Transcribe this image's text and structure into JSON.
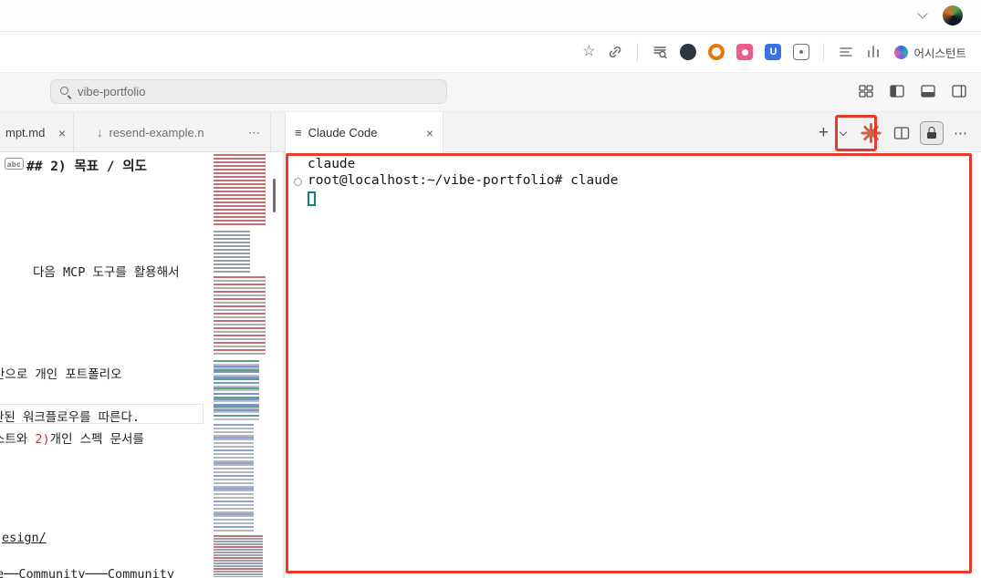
{
  "browser": {
    "assistant_label": "어시스턴트",
    "blue_ext_letter": "U"
  },
  "command_center": {
    "query": "vibe-portfolio"
  },
  "icons": {
    "star": "☆",
    "close": "×",
    "more": "⋯",
    "plus": "+",
    "file_arrow": "↓",
    "terminal_lines": "≡",
    "ellipsis": "⋯"
  },
  "tabs": [
    {
      "label": "mpt.md"
    },
    {
      "label": "resend-example.n"
    },
    {
      "label": "Claude Code"
    }
  ],
  "editor": {
    "badge": "abc",
    "heading": "## 2) 목표 / 의도",
    "line_mcp": "다음 MCP 도구를 활용해서",
    "line_portfolio": "반으로 개인 포트폴리오",
    "line_workflow": "관된 워크플로우를 따른다.",
    "spec_prefix": "스트와 ",
    "spec_num": "2)",
    "spec_suffix": "개인 스펙 문서를",
    "line_link": "esign/",
    "line_community": "e──Community───Community"
  },
  "terminal": {
    "echo": "claude",
    "prompt": "root@localhost:~/vibe-portfolio# claude"
  },
  "colors": {
    "annotation": "#e8392e",
    "claude_accent": "#d0603f",
    "cursor": "#12807c",
    "spec_number": "#cd3131",
    "file_icon": "#c14953"
  }
}
